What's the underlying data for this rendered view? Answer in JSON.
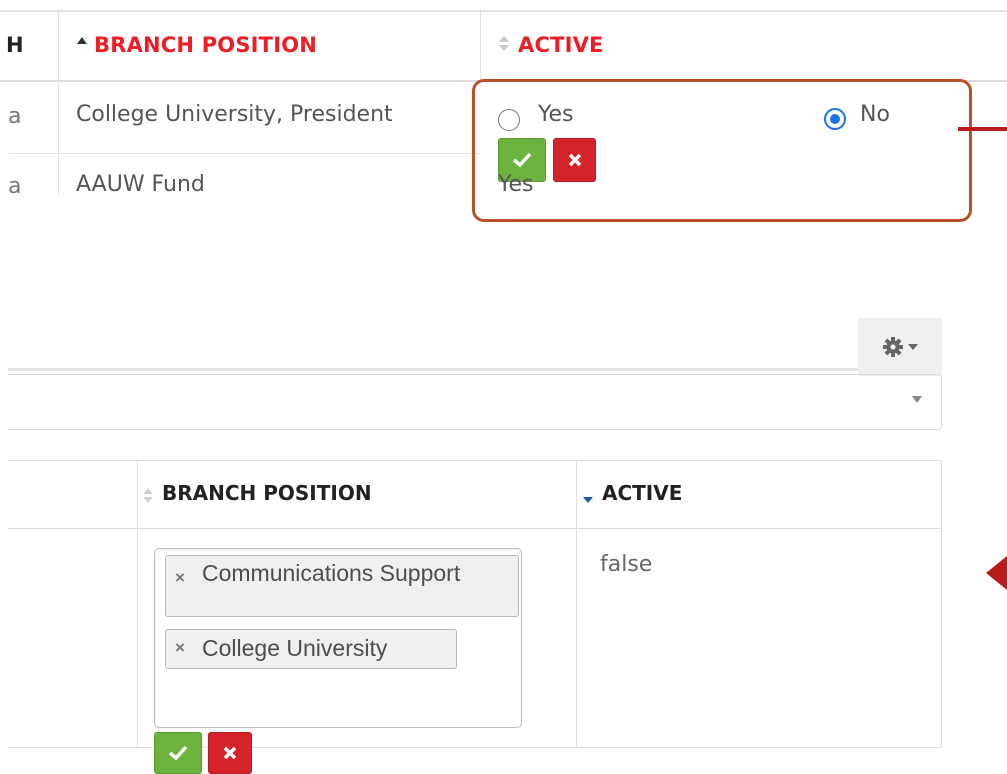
{
  "top_table": {
    "columns": [
      {
        "label": "H",
        "sort_icon": "sort-asc-icon"
      },
      {
        "label": "BRANCH POSITION",
        "sort_icon": "sort-asc-icon"
      },
      {
        "label": "ACTIVE",
        "sort_icon": "sort-both-icon"
      }
    ],
    "rows": [
      {
        "prefix": "a",
        "branch_position": "College University, President",
        "active_edit": {
          "options": [
            "Yes",
            "No"
          ],
          "selected": "No"
        }
      },
      {
        "prefix": "a",
        "branch_position": "AAUW Fund",
        "active": "Yes"
      }
    ]
  },
  "lower_table": {
    "columns": [
      {
        "label": "BRANCH POSITION",
        "sort_icon": "sort-both-icon"
      },
      {
        "label": "ACTIVE",
        "sort_icon": "sort-desc-icon"
      }
    ],
    "row": {
      "branch_position_tags": [
        "Communications Support",
        "College University"
      ],
      "active": "false"
    }
  },
  "toolbar": {
    "settings_icon": "gear-icon",
    "dropdown_icon": "caret-down-icon"
  },
  "colors": {
    "header_red": "#ee1c25",
    "confirm_green": "#6cb33e",
    "cancel_red": "#d5232b",
    "callout_border": "#b8502a",
    "arrow_red": "#b81c1c",
    "radio_blue": "#1e72e8"
  }
}
